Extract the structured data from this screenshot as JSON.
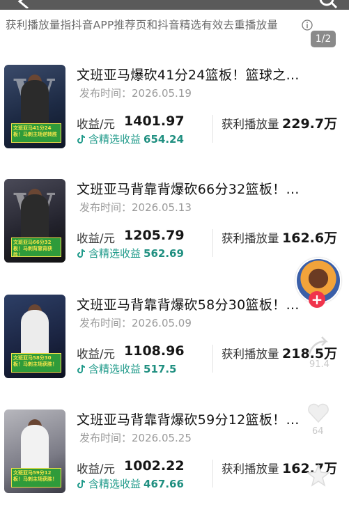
{
  "header": {
    "notice": "获利播放量指抖音APP推荐页和抖音精选有效去重播放量",
    "page_indicator": "1/2",
    "icons": {
      "back": "back-arrow-icon",
      "search": "search-icon",
      "info": "info-icon"
    }
  },
  "videos": [
    {
      "title": "文班亚马爆砍41分24篮板！篮球之…",
      "date_label": "发布时间：2026.05.19",
      "revenue_label": "收益/元",
      "revenue": "1401.97",
      "jingxuan_label": "含精选收益",
      "jingxuan": "654.24",
      "plays_label": "获利播放量",
      "plays": "229.7万",
      "thumb_caption": "文班亚马41分24板！马刺主场逆转胜"
    },
    {
      "title": "文班亚马背靠背爆砍66分32篮板！…",
      "date_label": "发布时间：2026.05.13",
      "revenue_label": "收益/元",
      "revenue": "1205.79",
      "jingxuan_label": "含精选收益",
      "jingxuan": "562.69",
      "plays_label": "获利播放量",
      "plays": "162.6万",
      "thumb_caption": "文班亚马66分32板！马刺背靠背获胜！"
    },
    {
      "title": "文班亚马背靠背爆砍58分30篮板！…",
      "date_label": "发布时间：2026.05.09",
      "revenue_label": "收益/元",
      "revenue": "1108.96",
      "jingxuan_label": "含精选收益",
      "jingxuan": "517.5",
      "plays_label": "获利播放量",
      "plays": "218.5万",
      "thumb_caption": "文班亚马58分30板！马刺主场获胜！"
    },
    {
      "title": "文班亚马背靠背爆砍59分12篮板！…",
      "date_label": "发布时间：2026.05.25",
      "revenue_label": "收益/元",
      "revenue": "1002.22",
      "jingxuan_label": "含精选收益",
      "jingxuan": "467.66",
      "plays_label": "获利播放量",
      "plays": "162.7万",
      "thumb_caption": "文班亚马59分12板！马刺主场获胜！"
    }
  ],
  "side_panel": {
    "follow_symbol": "+",
    "count_1": "91.4",
    "count_2": "64"
  },
  "colors": {
    "accent_green": "#1f9a8a",
    "follow_red": "#f0344c",
    "thumb_caption_bg": "#2f9b3a"
  }
}
